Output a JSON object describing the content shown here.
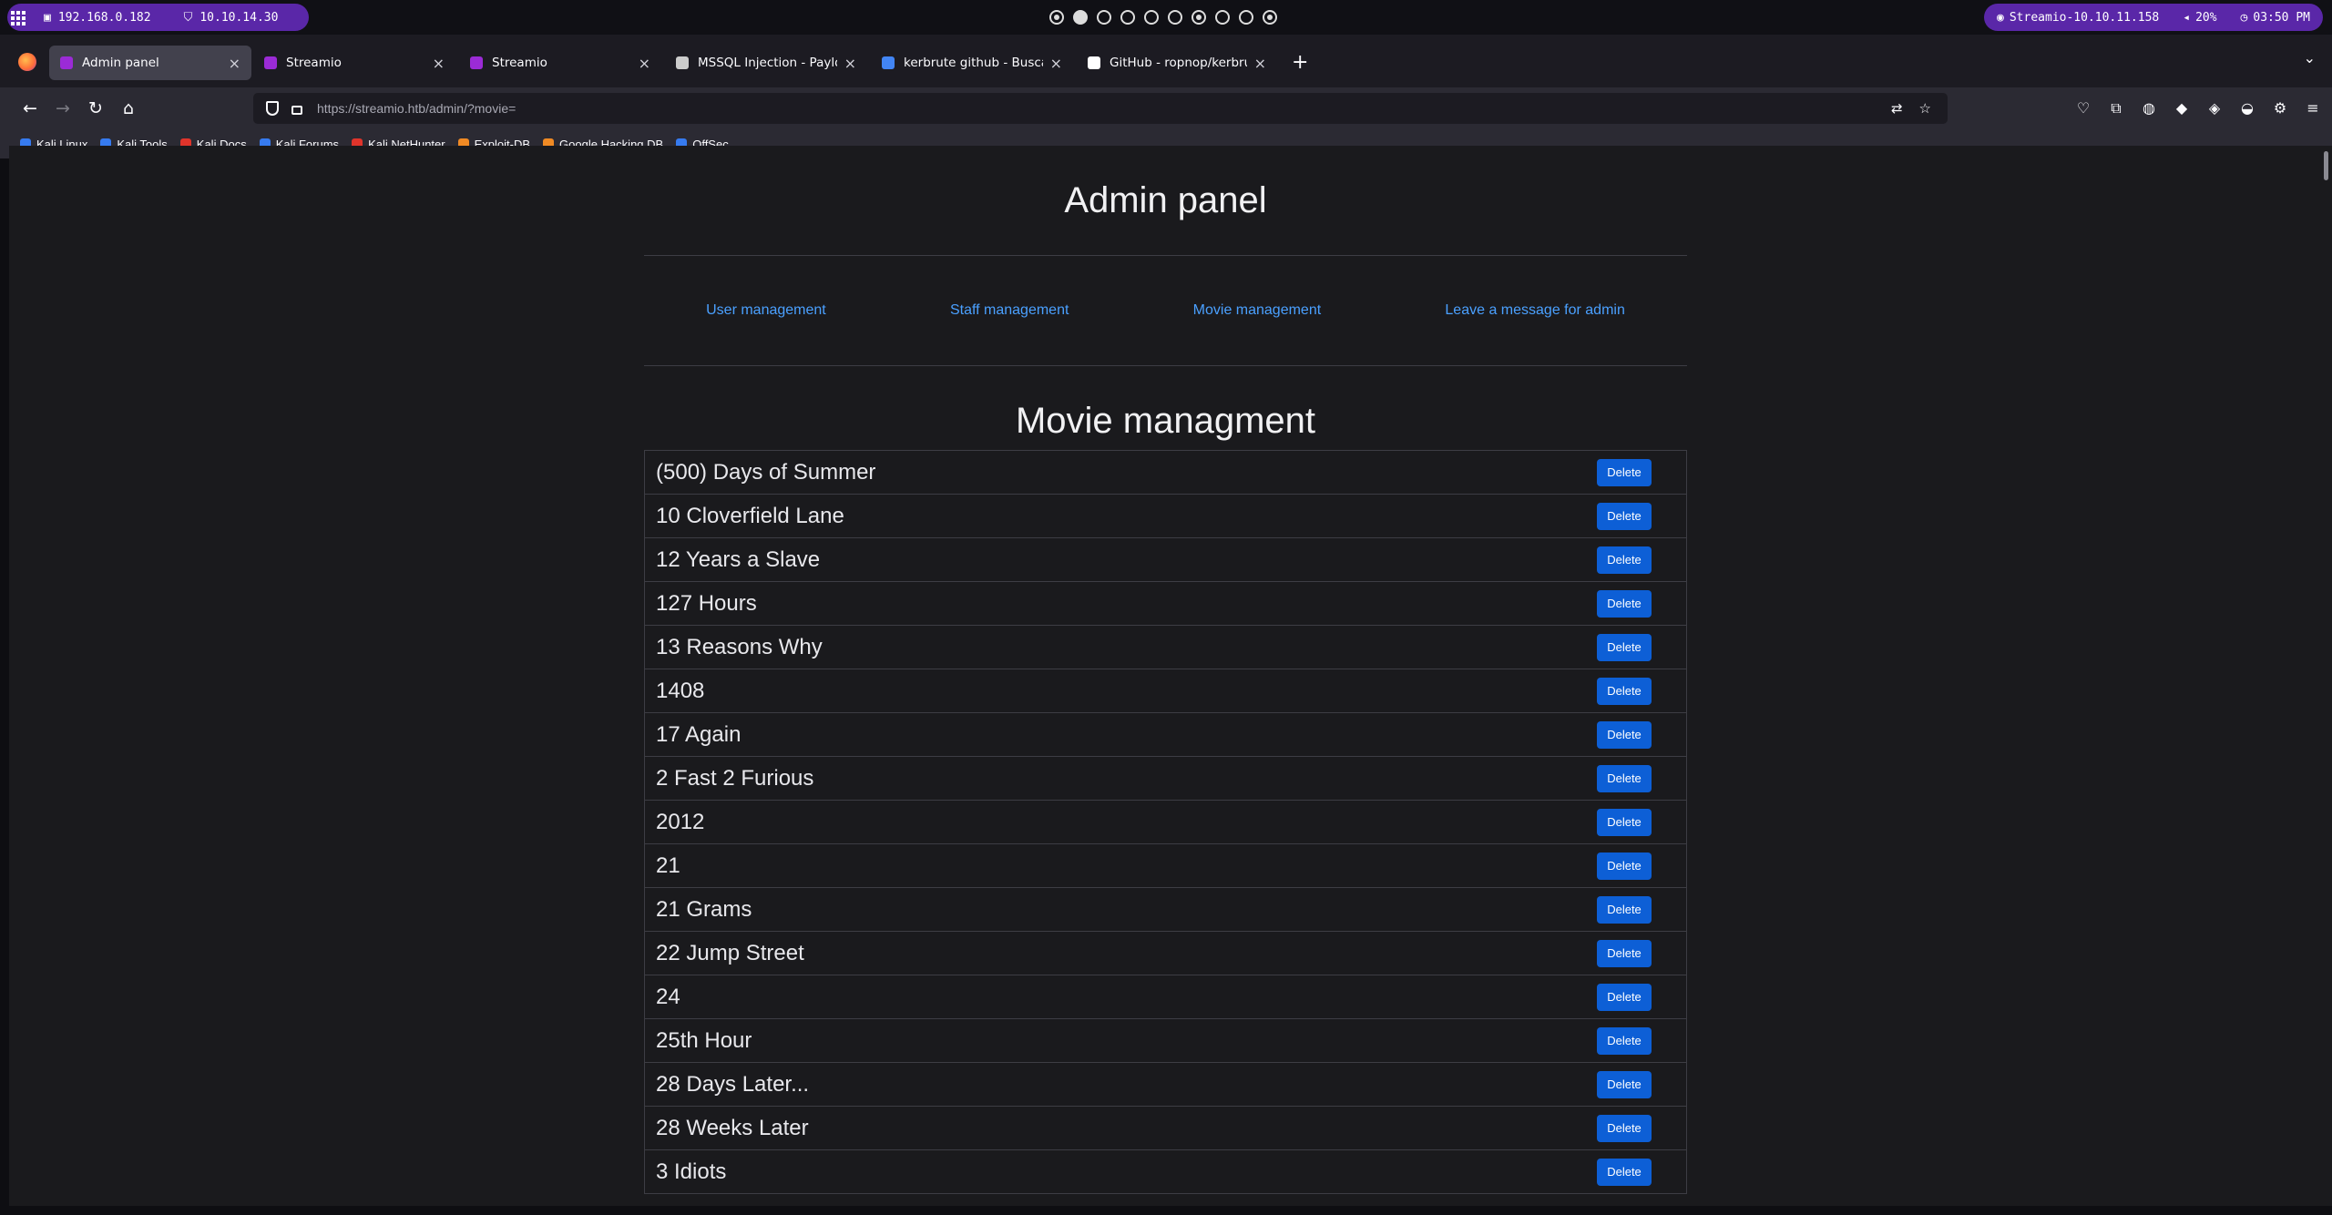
{
  "system_bar": {
    "left_ip": "192.168.0.182",
    "vpn_ip": "10.10.14.30",
    "target": "Streamio-10.10.11.158",
    "volume": "20%",
    "time": "03:50 PM",
    "workspaces": [
      "dot",
      "active",
      "empty",
      "empty",
      "empty",
      "empty",
      "dot",
      "empty",
      "empty",
      "dot"
    ]
  },
  "browser": {
    "tabs": [
      {
        "title": "Admin panel",
        "favicon_color": "#9b2bd6",
        "active": true
      },
      {
        "title": "Streamio",
        "favicon_color": "#9b2bd6",
        "active": false
      },
      {
        "title": "Streamio",
        "favicon_color": "#9b2bd6",
        "active": false
      },
      {
        "title": "MSSQL Injection - Payload",
        "favicon_color": "#cccccc",
        "active": false
      },
      {
        "title": "kerbrute github - Buscar c",
        "favicon_color": "#4285f4",
        "active": false
      },
      {
        "title": "GitHub - ropnop/kerbrute",
        "favicon_color": "#ffffff",
        "active": false
      }
    ],
    "url_host": "https://streamio.htb",
    "url_path": "/admin/?movie=",
    "bookmarks": [
      {
        "label": "Kali Linux",
        "color": "#367bf0"
      },
      {
        "label": "Kali Tools",
        "color": "#367bf0"
      },
      {
        "label": "Kali Docs",
        "color": "#e0342b"
      },
      {
        "label": "Kali Forums",
        "color": "#367bf0"
      },
      {
        "label": "Kali NetHunter",
        "color": "#e0342b"
      },
      {
        "label": "Exploit-DB",
        "color": "#f08a24"
      },
      {
        "label": "Google Hacking DB",
        "color": "#f08a24"
      },
      {
        "label": "OffSec",
        "color": "#367bf0"
      }
    ]
  },
  "page": {
    "title": "Admin panel",
    "nav": [
      "User management",
      "Staff management",
      "Movie management",
      "Leave a message for admin"
    ],
    "section_title": "Movie managment",
    "delete_label": "Delete",
    "movies": [
      "(500) Days of Summer",
      "10 Cloverfield Lane",
      "12 Years a Slave",
      "127 Hours",
      "13 Reasons Why",
      "1408",
      "17 Again",
      "2 Fast 2 Furious",
      "2012",
      "21",
      "21 Grams",
      "22 Jump Street",
      "24",
      "25th Hour",
      "28 Days Later...",
      "28 Weeks Later",
      "3 Idiots"
    ]
  }
}
